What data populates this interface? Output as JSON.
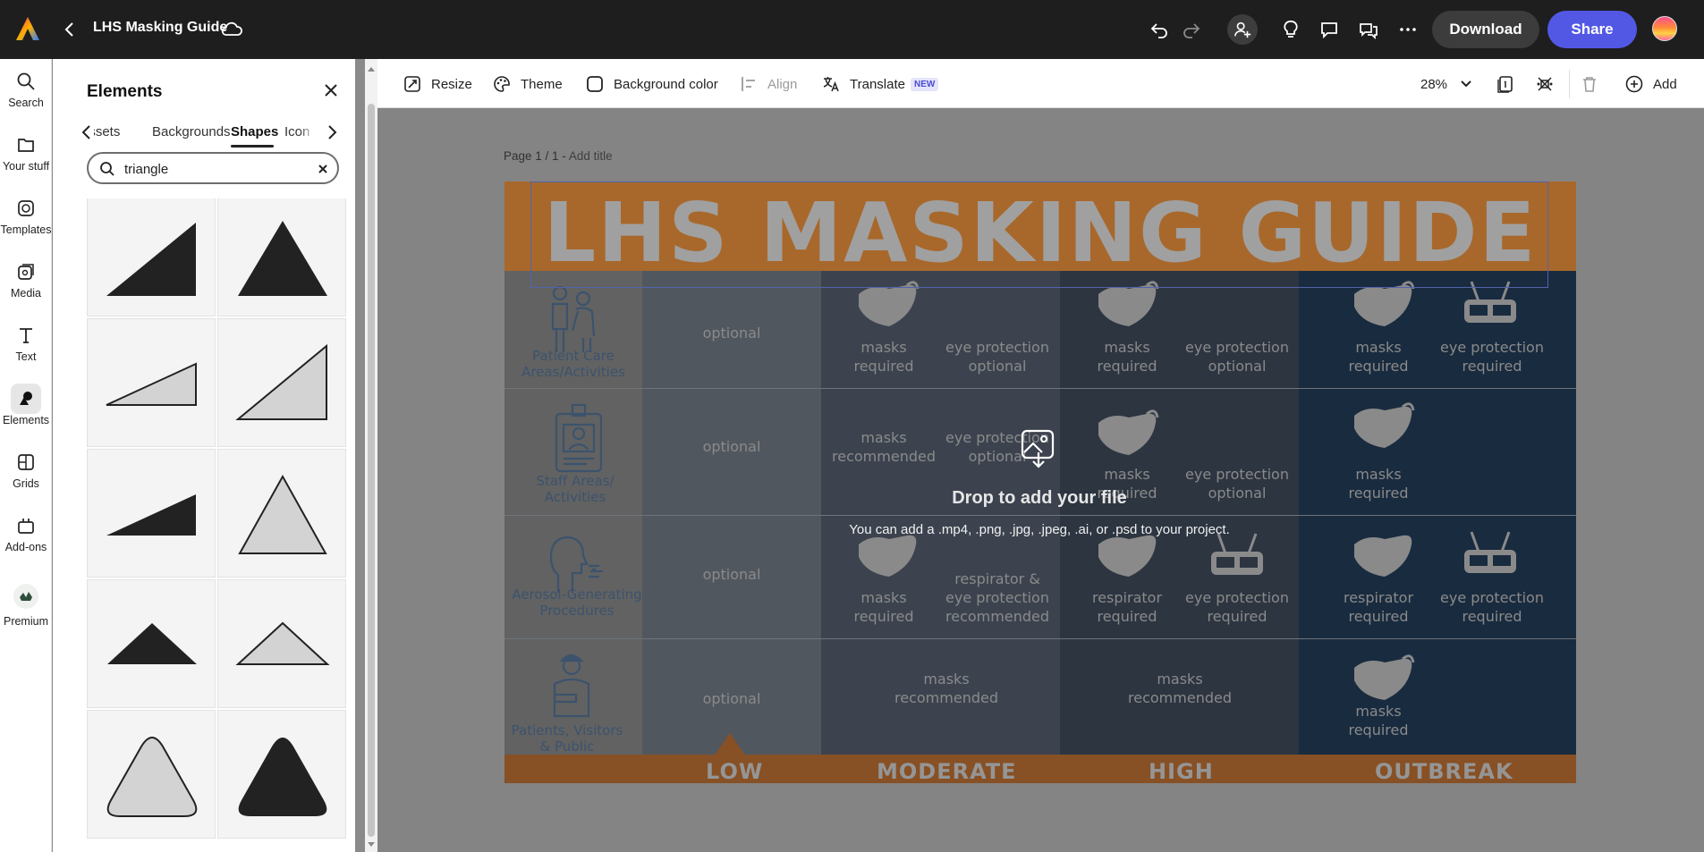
{
  "topbar": {
    "title": "LHS Masking Guide",
    "download_label": "Download",
    "share_label": "Share"
  },
  "rail": {
    "items": [
      {
        "label": "Search",
        "icon": "search-icon"
      },
      {
        "label": "Your stuff",
        "icon": "folder-icon"
      },
      {
        "label": "Templates",
        "icon": "templates-icon"
      },
      {
        "label": "Media",
        "icon": "media-icon"
      },
      {
        "label": "Text",
        "icon": "text-icon"
      },
      {
        "label": "Elements",
        "icon": "elements-icon",
        "active": true
      },
      {
        "label": "Grids",
        "icon": "grids-icon"
      },
      {
        "label": "Add-ons",
        "icon": "addons-icon"
      },
      {
        "label": "Premium",
        "icon": "premium-icon"
      }
    ]
  },
  "panel": {
    "title": "Elements",
    "tabs": [
      "assets",
      "Backgrounds",
      "Shapes",
      "Icon"
    ],
    "active_tab": "Shapes",
    "search_value": "triangle"
  },
  "toolbar": {
    "resize": "Resize",
    "theme": "Theme",
    "background_color": "Background color",
    "align": "Align",
    "translate": "Translate",
    "new_badge": "NEW",
    "zoom": "28%",
    "add": "Add"
  },
  "canvas": {
    "page_label": "Page 1 / 1 -",
    "add_title": "Add title",
    "heading": "LHS MASKING GUIDE",
    "rows": [
      {
        "label_1": "Patient Care",
        "label_2": "Areas/Activities"
      },
      {
        "label_1": "Staff Areas/",
        "label_2": "Activities"
      },
      {
        "label_1": "Aerosol-Generating",
        "label_2": "Procedures"
      },
      {
        "label_1": "Patients, Visitors",
        "label_2": "& Public"
      }
    ],
    "levels": [
      "LOW",
      "MODERATE",
      "HIGH",
      "OUTBREAK"
    ],
    "cells": {
      "optional": "optional",
      "masks": "masks",
      "required": "required",
      "recommended": "recommended",
      "eye_protection": "eye protection",
      "optional_word": "optional",
      "respirator": "respirator",
      "respirator_amp": "respirator &",
      "eye_protection_lc": "eye protection",
      "recommended_word": "recommended"
    }
  },
  "drop": {
    "title": "Drop to add your file",
    "subtitle": "You can add a .mp4, .png, .jpg, .jpeg, .ai, or .psd to your project."
  }
}
